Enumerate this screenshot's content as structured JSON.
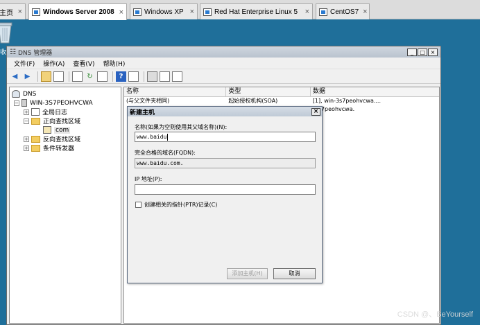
{
  "vm_tabs": [
    {
      "label": "主页",
      "active": false
    },
    {
      "label": "Windows Server 2008",
      "active": true
    },
    {
      "label": "Windows XP",
      "active": false
    },
    {
      "label": "Red Hat Enterprise Linux 5",
      "active": false
    },
    {
      "label": "CentOS7",
      "active": false
    }
  ],
  "desktop": {
    "label": "收"
  },
  "window": {
    "title": "DNS 管理器",
    "buttons": {
      "minimize": "_",
      "maximize": "□",
      "close": "×"
    }
  },
  "menu": [
    "文件(F)",
    "操作(A)",
    "查看(V)",
    "帮助(H)"
  ],
  "tree": {
    "root": "DNS",
    "server": "WIN-3S7PEOHVCWA",
    "global_logs": "全局日志",
    "forward_zones": "正向查找区域",
    "zone": "com",
    "reverse_zones": "反向查找区域",
    "conditional_forwarders": "条件转发器",
    "expand": "+",
    "collapse": "−"
  },
  "list": {
    "columns": [
      "名称",
      "类型",
      "数据"
    ],
    "rows": [
      {
        "name": "(与父文件夹相同)",
        "type": "起始授权机构(SOA)",
        "data": "[1], win-3s7peohvcwa...."
      },
      {
        "name": "",
        "type": "",
        "data": "-3s7peohvcwa."
      }
    ]
  },
  "dialog": {
    "title": "新建主机",
    "close": "×",
    "name_label": "名称(如果为空则使用其父域名称)(N):",
    "name_value": "www.baidu",
    "fqdn_label": "完全合格的域名(FQDN):",
    "fqdn_value": "www.baidu.com.",
    "ip_label": "IP 地址(P):",
    "ip_value": "",
    "ptr_label": "创建相关的指针(PTR)记录(C)",
    "ptr_checked": false,
    "add_button": "添加主机(H)",
    "cancel_button": "取消"
  },
  "watermark": "CSDN @、BeYourself"
}
